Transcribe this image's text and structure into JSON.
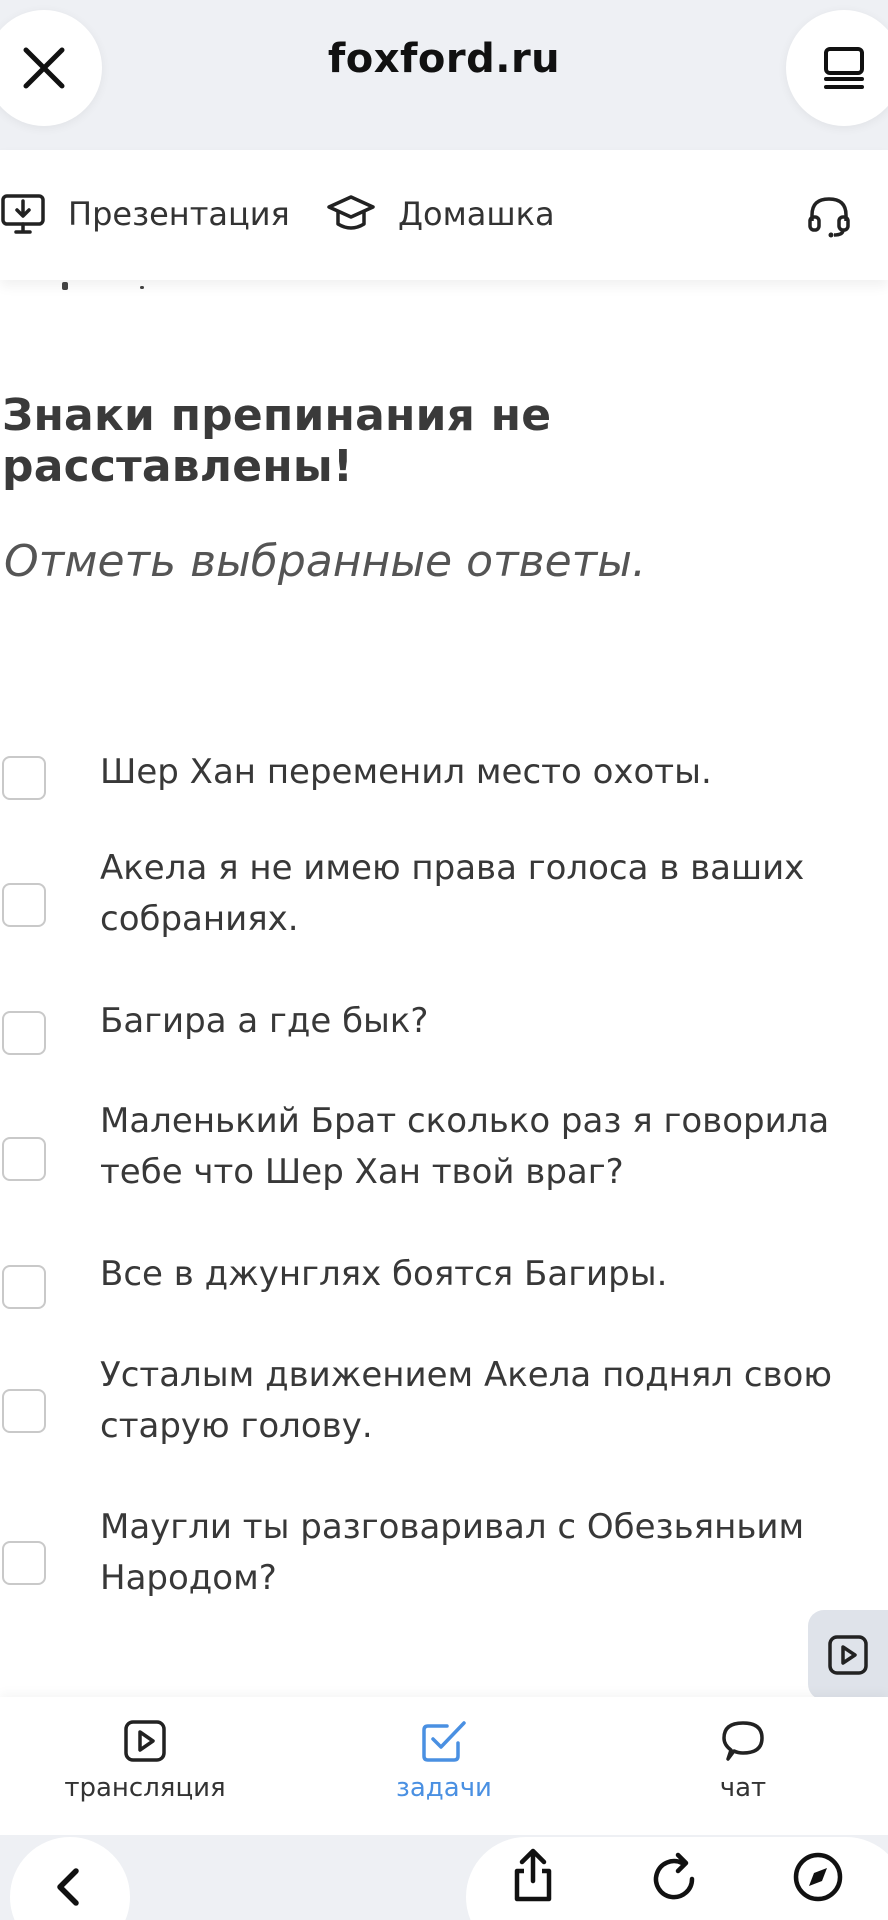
{
  "browser": {
    "site_title": "foxford.ru",
    "close_icon": "close-icon",
    "menu_icon": "tabs-menu-icon"
  },
  "toolbar": {
    "presentation_label": "Презентация",
    "homework_label": "Домашка",
    "icons": [
      "presentation-download-icon",
      "graduation-cap-icon",
      "headset-icon"
    ]
  },
  "content": {
    "warning": "Знаки препинания не расставлены!",
    "instruction": "Отметь выбранные ответы.",
    "options": [
      {
        "text": "Шер Хан переменил место охоты.",
        "checked": false
      },
      {
        "text": "Акела я не имею права голоса в ваших собраниях.",
        "checked": false
      },
      {
        "text": "Багира а где бык?",
        "checked": false
      },
      {
        "text": "Маленький Брат сколько раз я говорила тебе что Шер Хан твой враг?",
        "checked": false
      },
      {
        "text": "Все в джунглях боятся Багиры.",
        "checked": false
      },
      {
        "text": "Усталым движением Акела поднял свою старую голову.",
        "checked": false
      },
      {
        "text": "Маугли ты разговаривал с Обезьяньим Народом?",
        "checked": false
      }
    ]
  },
  "app_nav": {
    "items": [
      {
        "label": "трансляция",
        "icon": "play-icon",
        "active": false
      },
      {
        "label": "задачи",
        "icon": "checkbox-icon",
        "active": true
      },
      {
        "label": "чат",
        "icon": "chat-bubble-icon",
        "active": false
      }
    ]
  },
  "colors": {
    "accent": "#4a90e2",
    "text": "#333333",
    "chrome_bg": "#eef0f4"
  }
}
